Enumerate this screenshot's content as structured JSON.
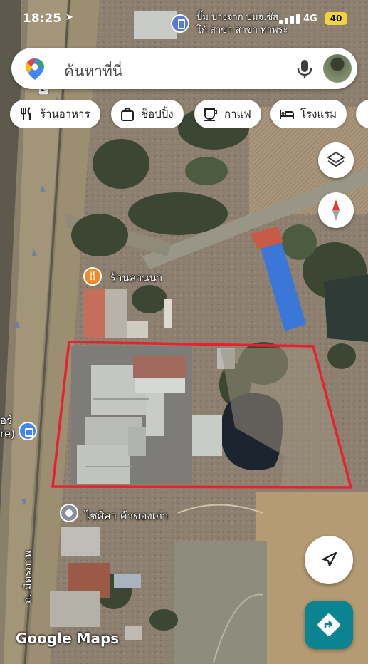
{
  "status_bar": {
    "time": "18:25",
    "network": "4G",
    "battery": "40"
  },
  "top_poi": {
    "line1": "ปั๊ม บางจาก บมจ.ซั่ส",
    "line2": "โก้ สาขา สาขา ท่าพระ"
  },
  "search": {
    "placeholder": "ค้นหาที่นี่"
  },
  "chips": [
    {
      "label": "ร้านอาหาร",
      "icon": "fork-knife-icon"
    },
    {
      "label": "ช็อปปิ้ง",
      "icon": "shopping-bag-icon"
    },
    {
      "label": "กาแฟ",
      "icon": "coffee-cup-icon"
    },
    {
      "label": "โรงแรม",
      "icon": "bed-icon"
    }
  ],
  "map": {
    "places": [
      {
        "name": "ร้านลานนา",
        "icon": "restaurant-pin-icon",
        "color": "#f08a24"
      },
      {
        "name": "ไชศิลา ค้าของเก่า",
        "icon": "place-pin-icon",
        "color": "#8a8f98"
      }
    ],
    "partial_left_label_1": "อร์",
    "partial_left_label_2": "re)",
    "road_label": "ถ. มิตรภาพ",
    "highway_shield": "2",
    "watermark": "Google Maps",
    "boundary_color": "#e8202f"
  },
  "brand_colors": {
    "directions_button": "#0c8390",
    "compass_needle": "#e53935"
  }
}
